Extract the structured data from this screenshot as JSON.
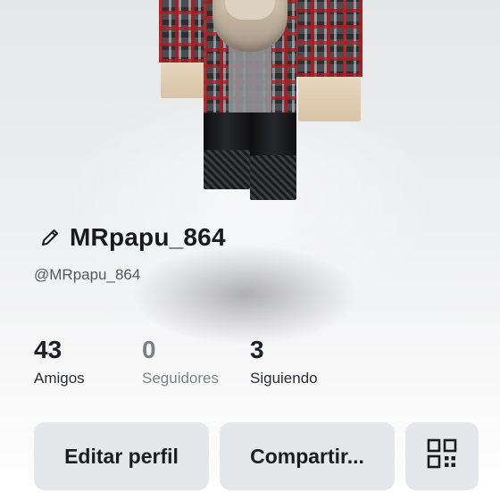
{
  "profile": {
    "display_name": "MRpapu_864",
    "username": "@MRpapu_864"
  },
  "stats": [
    {
      "value": "43",
      "label": "Amigos"
    },
    {
      "value": "0",
      "label": "Seguidores"
    },
    {
      "value": "3",
      "label": "Siguiendo"
    }
  ],
  "actions": {
    "edit_label": "Editar perfil",
    "share_label": "Compartir..."
  },
  "icons": {
    "edit": "pencil-icon",
    "qr": "qr-code-icon"
  }
}
